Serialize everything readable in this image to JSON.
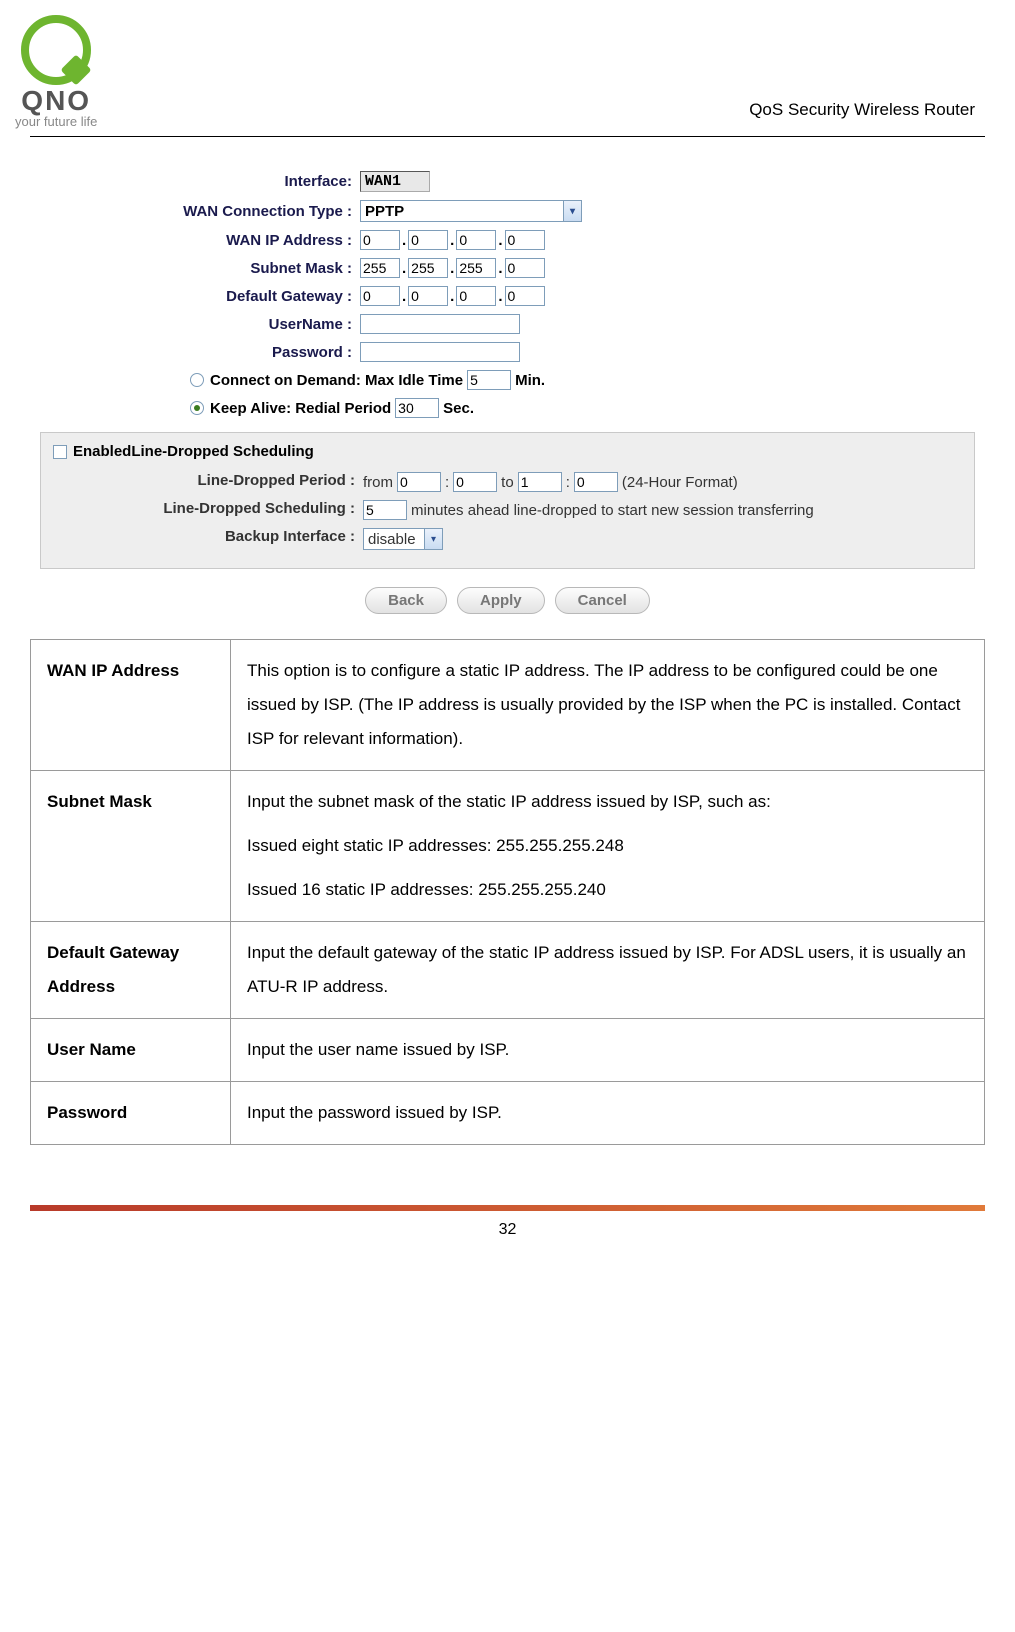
{
  "header": {
    "logo_text": "QNO",
    "logo_sub": "your future life",
    "title": "QoS Security Wireless Router"
  },
  "form": {
    "interface_label": "Interface:",
    "interface_value": "WAN1",
    "conn_type_label": "WAN  Connection Type :",
    "conn_type_value": "PPTP",
    "wan_ip_label": "WAN  IP Address :",
    "wan_ip": [
      "0",
      "0",
      "0",
      "0"
    ],
    "subnet_label": "Subnet Mask :",
    "subnet": [
      "255",
      "255",
      "255",
      "0"
    ],
    "gateway_label": "Default Gateway :",
    "gateway": [
      "0",
      "0",
      "0",
      "0"
    ],
    "username_label": "UserName :",
    "username_value": "",
    "password_label": "Password :",
    "password_value": "",
    "connect_on_demand_label": "Connect on Demand: Max Idle Time",
    "connect_on_demand_value": "5",
    "connect_on_demand_unit": "Min.",
    "keep_alive_label": "Keep Alive: Redial Period",
    "keep_alive_value": "30",
    "keep_alive_unit": "Sec."
  },
  "sched": {
    "title": "EnabledLine-Dropped Scheduling",
    "period_label": "Line-Dropped Period :",
    "period_from": "from",
    "period_to": "to",
    "p1": "0",
    "p2": "0",
    "p3": "1",
    "p4": "0",
    "period_note": "(24-Hour Format)",
    "sched_label": "Line-Dropped Scheduling :",
    "sched_val": "5",
    "sched_text": "minutes ahead line-dropped to start new session transferring",
    "backup_label": "Backup Interface :",
    "backup_value": "disable"
  },
  "buttons": {
    "back": "Back",
    "apply": "Apply",
    "cancel": "Cancel"
  },
  "table": {
    "r1k": "WAN IP Address",
    "r1v": "This option is to configure a static IP address. The IP address to be configured could be one issued by ISP. (The IP address is usually provided by the ISP when the PC is installed. Contact ISP for relevant information).",
    "r2k": "Subnet Mask",
    "r2v1": "Input the subnet mask of the static IP address issued by ISP, such as:",
    "r2v2": "Issued eight static IP addresses: 255.255.255.248",
    "r2v3": "Issued 16 static IP addresses: 255.255.255.240",
    "r3k": "Default Gateway Address",
    "r3v": "Input the default gateway of the static IP address issued by ISP. For ADSL users, it is usually an ATU-R IP address.",
    "r4k": "User Name",
    "r4v": "Input the user name issued by ISP.",
    "r5k": "Password",
    "r5v": "Input the password issued by ISP."
  },
  "page_number": "32"
}
